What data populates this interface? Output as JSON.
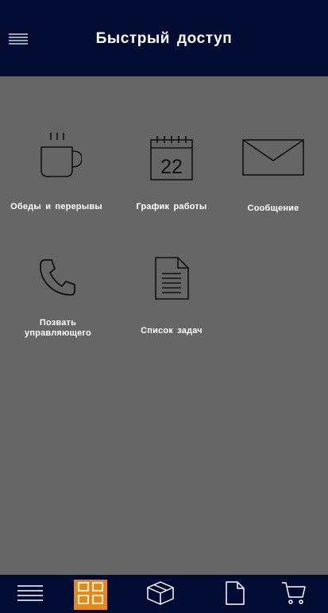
{
  "header": {
    "title": "Быстрый  доступ",
    "menu_icon": "hamburger-menu-icon"
  },
  "tiles": [
    {
      "label": "Обеды  и  перерывы",
      "icon": "coffee-cup-icon"
    },
    {
      "label": "График  работы",
      "icon": "calendar-icon",
      "calendar_day": "22"
    },
    {
      "label": "Сообщение",
      "icon": "envelope-icon"
    },
    {
      "label": "Позвать управляющего",
      "icon": "phone-icon"
    },
    {
      "label": "Список  задач",
      "icon": "document-icon"
    }
  ],
  "bottom_nav": {
    "items": [
      {
        "icon": "menu-list-icon",
        "active": false
      },
      {
        "icon": "grid-icon",
        "active": true
      },
      {
        "icon": "box-icon",
        "active": false
      },
      {
        "icon": "document-icon",
        "active": false
      },
      {
        "icon": "cart-icon",
        "active": false
      }
    ]
  },
  "colors": {
    "header_bg": "#020c33",
    "content_bg": "#666666",
    "active_nav": "#e38a1a",
    "text": "#ffffff",
    "icon_stroke": "#111111"
  }
}
